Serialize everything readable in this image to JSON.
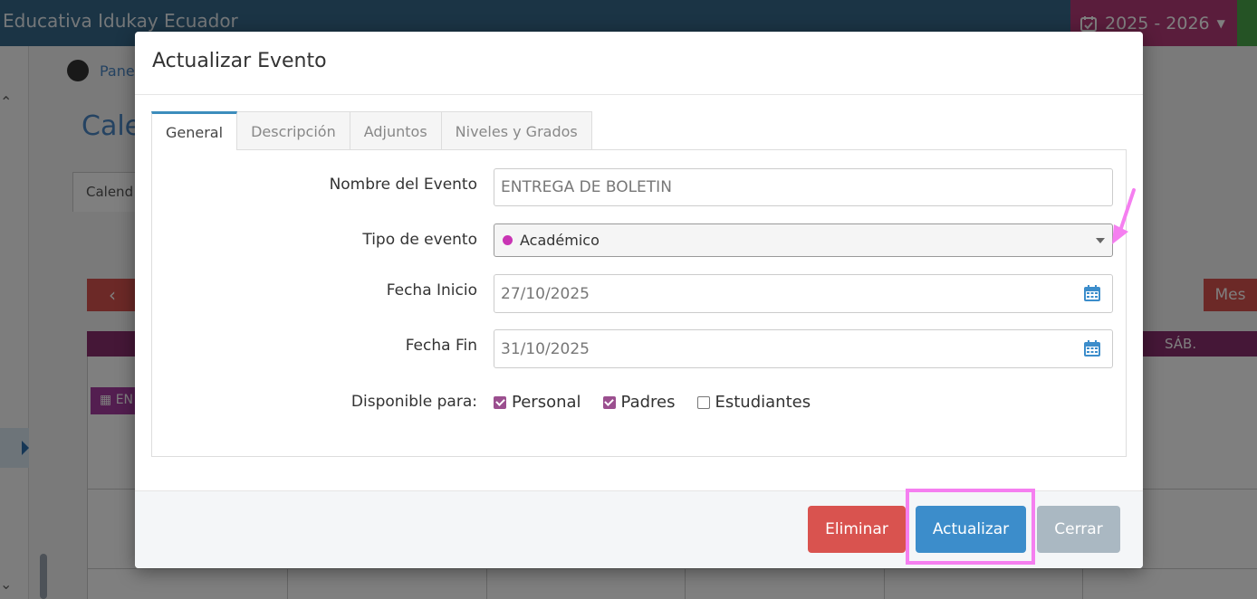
{
  "background": {
    "brand": "Educativa Idukay Ecuador",
    "school_year": "2025 - 2026",
    "breadcrumb": "Pane",
    "page_title": "Cale",
    "tab_label": "Calend",
    "view_button": "Mes",
    "weekday_sat": "SÁB.",
    "event_label": "EN"
  },
  "modal": {
    "title": "Actualizar Evento",
    "tabs": [
      {
        "label": "General",
        "active": true
      },
      {
        "label": "Descripción",
        "active": false
      },
      {
        "label": "Adjuntos",
        "active": false
      },
      {
        "label": "Niveles y Grados",
        "active": false
      }
    ],
    "form": {
      "event_name_label": "Nombre del Evento",
      "event_name_value": "ENTREGA DE BOLETIN",
      "event_type_label": "Tipo de evento",
      "event_type_value": "Académico",
      "event_type_color": "#c935b4",
      "start_date_label": "Fecha Inicio",
      "start_date_value": "27/10/2025",
      "end_date_label": "Fecha Fin",
      "end_date_value": "31/10/2025",
      "available_label": "Disponible para:",
      "audiences": [
        {
          "label": "Personal",
          "checked": true
        },
        {
          "label": "Padres",
          "checked": true
        },
        {
          "label": "Estudiantes",
          "checked": false
        }
      ]
    },
    "footer": {
      "delete_label": "Eliminar",
      "update_label": "Actualizar",
      "close_label": "Cerrar"
    }
  },
  "colors": {
    "highlight": "#f57ff0",
    "primary": "#3c8dcb",
    "danger": "#d9534f"
  }
}
